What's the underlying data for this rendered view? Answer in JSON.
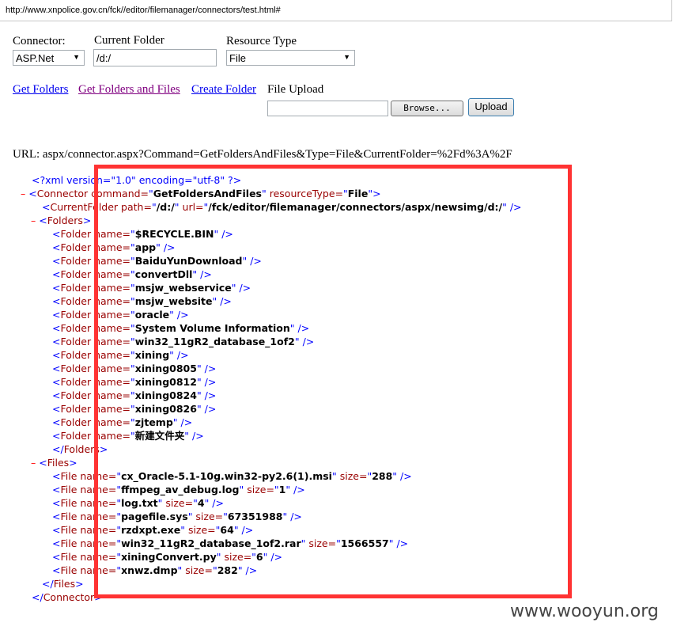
{
  "address_bar": {
    "url": "http://www.xnpolice.gov.cn/fck//editor/filemanager/connectors/test.html#"
  },
  "form": {
    "connector_label": "Connector:",
    "connector_value": "ASP.Net",
    "current_folder_label": "Current Folder",
    "current_folder_value": "/d:/",
    "resource_type_label": "Resource Type",
    "resource_type_value": "File",
    "get_folders": "Get Folders",
    "get_folders_and_files": "Get Folders and Files",
    "create_folder": "Create Folder",
    "file_upload_label": "File Upload",
    "browse_button": "Browse...",
    "upload_button": "Upload"
  },
  "url_line": "URL: aspx/connector.aspx?Command=GetFoldersAndFiles&Type=File&CurrentFolder=%2Fd%3A%2F",
  "xml": {
    "declaration": "<?xml version=\"1.0\" encoding=\"utf-8\" ?>",
    "collapse_toggle": "–",
    "connector_tag": "Connector",
    "connector_attr_command": "command",
    "connector_command": "GetFoldersAndFiles",
    "connector_attr_resource_type": "resourceType",
    "connector_resource_type": "File",
    "current_folder_tag": "CurrentFolder",
    "current_folder_attr_path": "path",
    "current_folder_path": "/d:/",
    "current_folder_attr_url": "url",
    "current_folder_url": "/fck/editor/filemanager/connectors/aspx/newsimg/d:/",
    "folders_tag": "Folders",
    "folder_tag": "Folder",
    "name_attr": "name",
    "folders": [
      "$RECYCLE.BIN",
      "app",
      "BaiduYunDownload",
      "convertDll",
      "msjw_webservice",
      "msjw_website",
      "oracle",
      "System Volume Information",
      "win32_11gR2_database_1of2",
      "xining",
      "xining0805",
      "xining0812",
      "xining0824",
      "xining0826",
      "zjtemp",
      "新建文件夹"
    ],
    "files_tag": "Files",
    "file_tag": "File",
    "size_attr": "size",
    "files": [
      {
        "name": "cx_Oracle-5.1-10g.win32-py2.6(1).msi",
        "size": "288"
      },
      {
        "name": "ffmpeg_av_debug.log",
        "size": "1"
      },
      {
        "name": "log.txt",
        "size": "4"
      },
      {
        "name": "pagefile.sys",
        "size": "67351988"
      },
      {
        "name": "rzdxpt.exe",
        "size": "64"
      },
      {
        "name": "win32_11gR2_database_1of2.rar",
        "size": "1566557"
      },
      {
        "name": "xiningConvert.py",
        "size": "6"
      },
      {
        "name": "xnwz.dmp",
        "size": "282"
      }
    ]
  },
  "watermark": "www.wooyun.org"
}
